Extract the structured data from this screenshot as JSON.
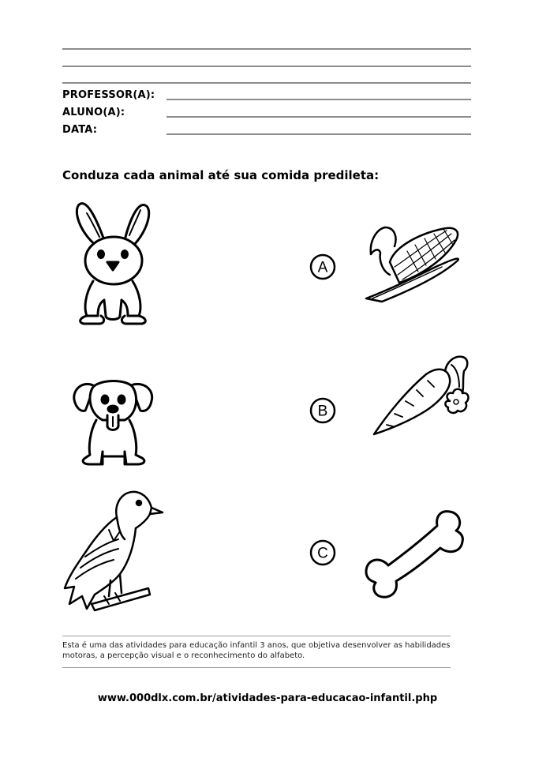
{
  "header": {
    "professor_label": "PROFESSOR(A):",
    "aluno_label": "ALUNO(A):",
    "data_label": "DATA:"
  },
  "instruction": "Conduza cada animal até sua comida predileta:",
  "options": [
    {
      "letter": "A",
      "food_icon": "corn-icon"
    },
    {
      "letter": "B",
      "food_icon": "carrot-icon"
    },
    {
      "letter": "C",
      "food_icon": "bone-icon"
    }
  ],
  "animals": [
    "rabbit-icon",
    "dog-icon",
    "bird-icon"
  ],
  "footer": {
    "description": "Esta é uma das atividades para educação infantil 3 anos, que objetiva desenvolver as habilidades motoras, a percepção visual e o reconhecimento do alfabeto.",
    "url": "www.000dlx.com.br/atividades-para-educacao-infantil.php"
  }
}
